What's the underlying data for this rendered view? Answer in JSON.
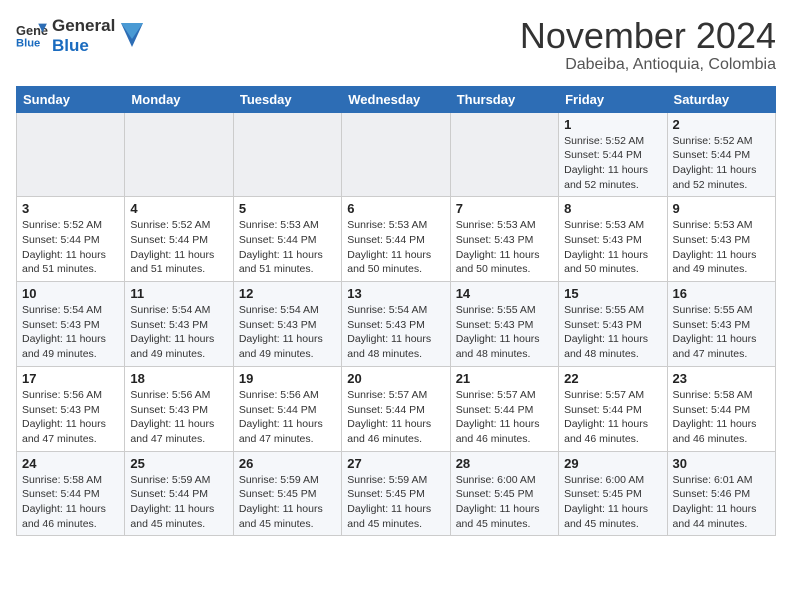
{
  "header": {
    "logo_general": "General",
    "logo_blue": "Blue",
    "month_year": "November 2024",
    "location": "Dabeiba, Antioquia, Colombia"
  },
  "weekdays": [
    "Sunday",
    "Monday",
    "Tuesday",
    "Wednesday",
    "Thursday",
    "Friday",
    "Saturday"
  ],
  "weeks": [
    [
      {
        "day": "",
        "info": ""
      },
      {
        "day": "",
        "info": ""
      },
      {
        "day": "",
        "info": ""
      },
      {
        "day": "",
        "info": ""
      },
      {
        "day": "",
        "info": ""
      },
      {
        "day": "1",
        "info": "Sunrise: 5:52 AM\nSunset: 5:44 PM\nDaylight: 11 hours\nand 52 minutes."
      },
      {
        "day": "2",
        "info": "Sunrise: 5:52 AM\nSunset: 5:44 PM\nDaylight: 11 hours\nand 52 minutes."
      }
    ],
    [
      {
        "day": "3",
        "info": "Sunrise: 5:52 AM\nSunset: 5:44 PM\nDaylight: 11 hours\nand 51 minutes."
      },
      {
        "day": "4",
        "info": "Sunrise: 5:52 AM\nSunset: 5:44 PM\nDaylight: 11 hours\nand 51 minutes."
      },
      {
        "day": "5",
        "info": "Sunrise: 5:53 AM\nSunset: 5:44 PM\nDaylight: 11 hours\nand 51 minutes."
      },
      {
        "day": "6",
        "info": "Sunrise: 5:53 AM\nSunset: 5:44 PM\nDaylight: 11 hours\nand 50 minutes."
      },
      {
        "day": "7",
        "info": "Sunrise: 5:53 AM\nSunset: 5:43 PM\nDaylight: 11 hours\nand 50 minutes."
      },
      {
        "day": "8",
        "info": "Sunrise: 5:53 AM\nSunset: 5:43 PM\nDaylight: 11 hours\nand 50 minutes."
      },
      {
        "day": "9",
        "info": "Sunrise: 5:53 AM\nSunset: 5:43 PM\nDaylight: 11 hours\nand 49 minutes."
      }
    ],
    [
      {
        "day": "10",
        "info": "Sunrise: 5:54 AM\nSunset: 5:43 PM\nDaylight: 11 hours\nand 49 minutes."
      },
      {
        "day": "11",
        "info": "Sunrise: 5:54 AM\nSunset: 5:43 PM\nDaylight: 11 hours\nand 49 minutes."
      },
      {
        "day": "12",
        "info": "Sunrise: 5:54 AM\nSunset: 5:43 PM\nDaylight: 11 hours\nand 49 minutes."
      },
      {
        "day": "13",
        "info": "Sunrise: 5:54 AM\nSunset: 5:43 PM\nDaylight: 11 hours\nand 48 minutes."
      },
      {
        "day": "14",
        "info": "Sunrise: 5:55 AM\nSunset: 5:43 PM\nDaylight: 11 hours\nand 48 minutes."
      },
      {
        "day": "15",
        "info": "Sunrise: 5:55 AM\nSunset: 5:43 PM\nDaylight: 11 hours\nand 48 minutes."
      },
      {
        "day": "16",
        "info": "Sunrise: 5:55 AM\nSunset: 5:43 PM\nDaylight: 11 hours\nand 47 minutes."
      }
    ],
    [
      {
        "day": "17",
        "info": "Sunrise: 5:56 AM\nSunset: 5:43 PM\nDaylight: 11 hours\nand 47 minutes."
      },
      {
        "day": "18",
        "info": "Sunrise: 5:56 AM\nSunset: 5:43 PM\nDaylight: 11 hours\nand 47 minutes."
      },
      {
        "day": "19",
        "info": "Sunrise: 5:56 AM\nSunset: 5:44 PM\nDaylight: 11 hours\nand 47 minutes."
      },
      {
        "day": "20",
        "info": "Sunrise: 5:57 AM\nSunset: 5:44 PM\nDaylight: 11 hours\nand 46 minutes."
      },
      {
        "day": "21",
        "info": "Sunrise: 5:57 AM\nSunset: 5:44 PM\nDaylight: 11 hours\nand 46 minutes."
      },
      {
        "day": "22",
        "info": "Sunrise: 5:57 AM\nSunset: 5:44 PM\nDaylight: 11 hours\nand 46 minutes."
      },
      {
        "day": "23",
        "info": "Sunrise: 5:58 AM\nSunset: 5:44 PM\nDaylight: 11 hours\nand 46 minutes."
      }
    ],
    [
      {
        "day": "24",
        "info": "Sunrise: 5:58 AM\nSunset: 5:44 PM\nDaylight: 11 hours\nand 46 minutes."
      },
      {
        "day": "25",
        "info": "Sunrise: 5:59 AM\nSunset: 5:44 PM\nDaylight: 11 hours\nand 45 minutes."
      },
      {
        "day": "26",
        "info": "Sunrise: 5:59 AM\nSunset: 5:45 PM\nDaylight: 11 hours\nand 45 minutes."
      },
      {
        "day": "27",
        "info": "Sunrise: 5:59 AM\nSunset: 5:45 PM\nDaylight: 11 hours\nand 45 minutes."
      },
      {
        "day": "28",
        "info": "Sunrise: 6:00 AM\nSunset: 5:45 PM\nDaylight: 11 hours\nand 45 minutes."
      },
      {
        "day": "29",
        "info": "Sunrise: 6:00 AM\nSunset: 5:45 PM\nDaylight: 11 hours\nand 45 minutes."
      },
      {
        "day": "30",
        "info": "Sunrise: 6:01 AM\nSunset: 5:46 PM\nDaylight: 11 hours\nand 44 minutes."
      }
    ]
  ]
}
